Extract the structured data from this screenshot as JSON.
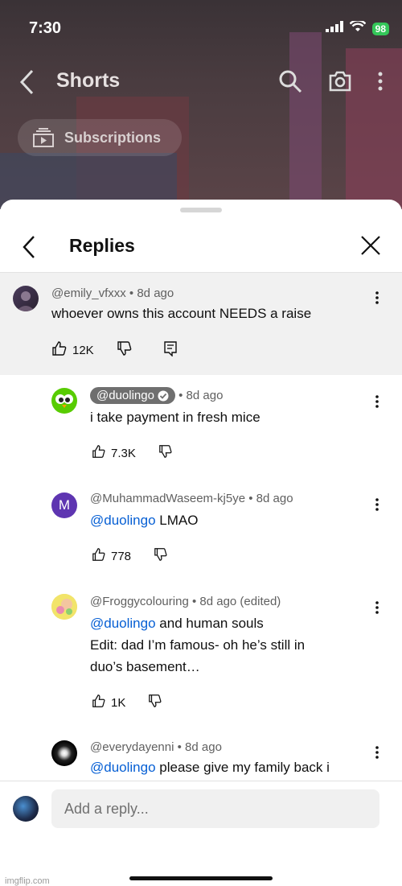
{
  "status_bar": {
    "time": "7:30",
    "battery": "98"
  },
  "topbar": {
    "title": "Shorts",
    "subscriptions_label": "Subscriptions"
  },
  "sheet": {
    "title": "Replies"
  },
  "parent_comment": {
    "handle": "@emily_vfxxx",
    "age": "8d ago",
    "text": "whoever owns this account NEEDS a raise",
    "likes": "12K"
  },
  "replies": [
    {
      "handle": "@duolingo",
      "age": "8d ago",
      "text": "i take payment in fresh mice",
      "likes": "7.3K",
      "verified": true
    },
    {
      "handle": "@MuhammadWaseem-kj5ye",
      "age": "8d ago",
      "avatar_letter": "M",
      "mention": "@duolingo",
      "text": "LMAO",
      "likes": "778"
    },
    {
      "handle": "@Froggycolouring",
      "age": "8d ago (edited)",
      "mention": "@duolingo",
      "text_line1": "and human souls",
      "text_line2": "Edit: dad I’m famous- oh he’s still in",
      "text_line3": "duo’s basement…",
      "likes": "1K"
    },
    {
      "handle": "@everydayenni",
      "age": "8d ago",
      "mention": "@duolingo",
      "text": "please give my family back i"
    }
  ],
  "compose": {
    "placeholder": "Add a reply..."
  },
  "watermark": "imgflip.com",
  "colors": {
    "mention": "#065fd4",
    "parent_bg": "#f1f1f1",
    "duolingo_green": "#58cc02",
    "avatar_purple": "#5e35b1"
  }
}
